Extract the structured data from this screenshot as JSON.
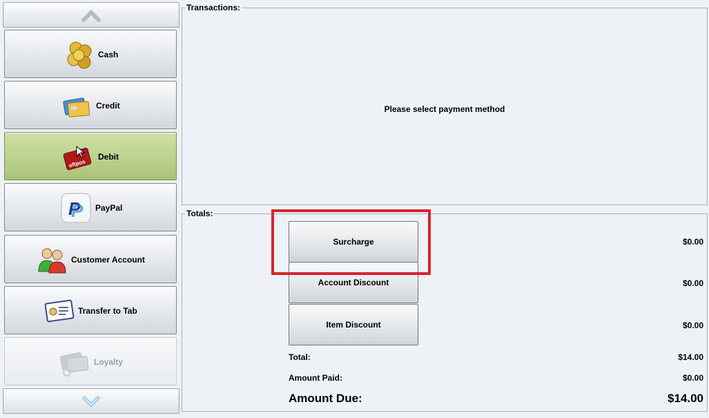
{
  "sidebar": {
    "scroll_up_icon": "chevron-up-icon",
    "scroll_down_icon": "chevron-down-icon",
    "methods": [
      {
        "label": "Cash",
        "icon": "coins-icon"
      },
      {
        "label": "Credit",
        "icon": "credit-card-icon"
      },
      {
        "label": "Debit",
        "icon": "eftpos-card-icon",
        "state": "selected"
      },
      {
        "label": "PayPal",
        "icon": "paypal-icon"
      },
      {
        "label": "Customer Account",
        "icon": "users-icon"
      },
      {
        "label": "Transfer to Tab",
        "icon": "tab-card-icon"
      },
      {
        "label": "Loyalty",
        "icon": "loyalty-card-icon",
        "state": "disabled"
      }
    ]
  },
  "transactions": {
    "title": "Transactions:",
    "message": "Please select payment method"
  },
  "totals": {
    "title": "Totals:",
    "surcharge": {
      "label": "Surcharge",
      "amount": "$0.00"
    },
    "account_discount": {
      "label": "Account Discount",
      "amount": "$0.00"
    },
    "item_discount": {
      "label": "Item Discount",
      "amount": "$0.00"
    },
    "total": {
      "label": "Total:",
      "amount": "$14.00"
    },
    "amount_paid": {
      "label": "Amount Paid:",
      "amount": "$0.00"
    },
    "amount_due": {
      "label": "Amount Due:",
      "amount": "$14.00"
    }
  },
  "colors": {
    "selected_bg": "#b9d08a",
    "highlight_border": "#d8232a"
  }
}
